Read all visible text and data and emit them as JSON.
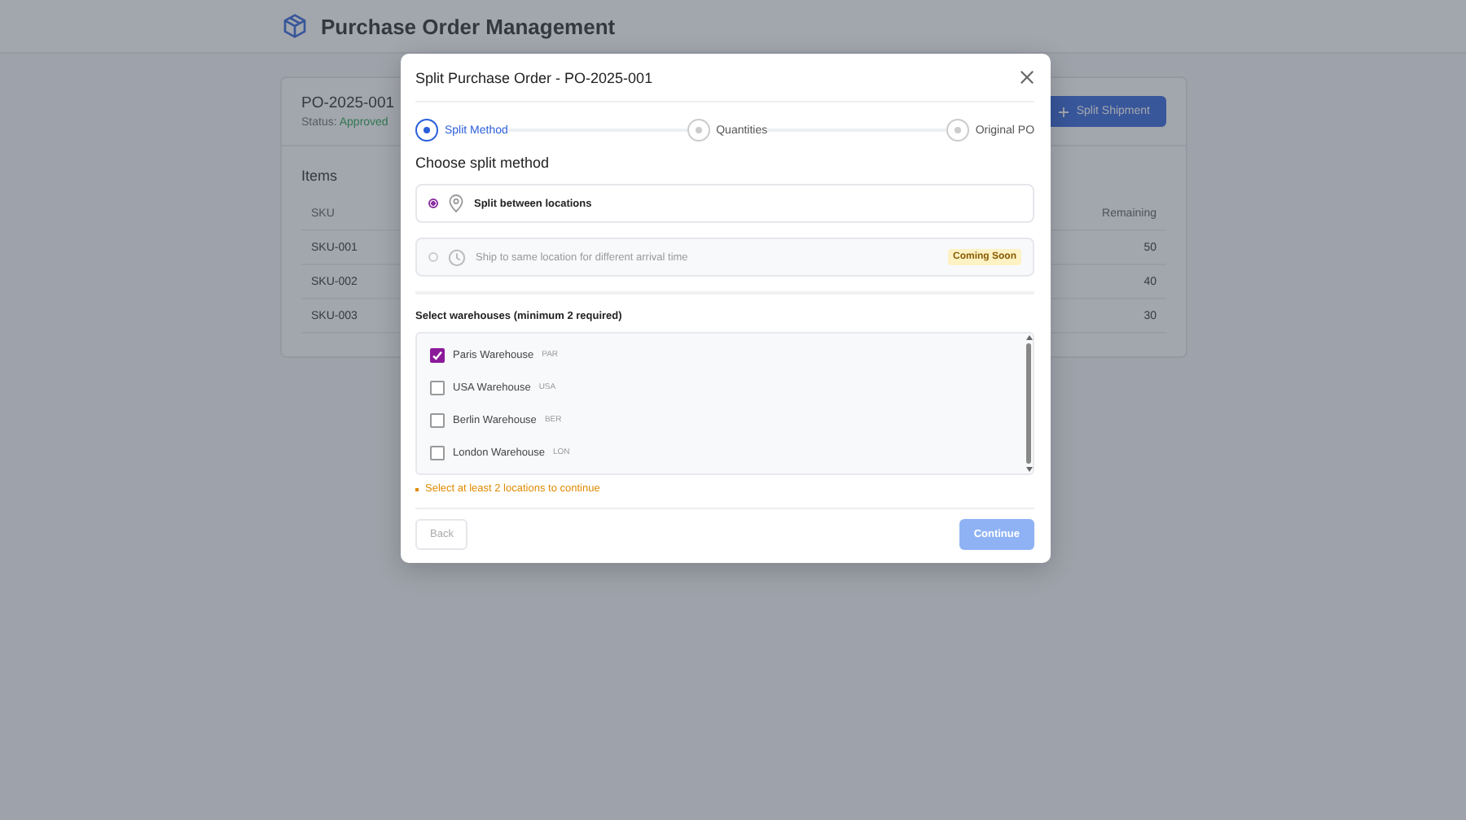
{
  "header": {
    "title": "Purchase Order Management"
  },
  "order": {
    "number": "PO-2025-001",
    "status_label": "Status:",
    "status": "Approved",
    "split_button": "Split Shipment",
    "items_title": "Items",
    "columns": [
      "SKU",
      "Remaining"
    ],
    "rows": [
      {
        "sku": "SKU-001",
        "remaining": "50"
      },
      {
        "sku": "SKU-002",
        "remaining": "40"
      },
      {
        "sku": "SKU-003",
        "remaining": "30"
      }
    ]
  },
  "dialog": {
    "title": "Split Purchase Order - PO-2025-001",
    "steps": [
      {
        "label": "Split Method",
        "selected": true
      },
      {
        "label": "Quantities",
        "selected": false
      },
      {
        "label": "Original PO",
        "selected": false
      }
    ],
    "method_heading": "Choose split method",
    "methods": [
      {
        "label": "Split between locations",
        "kind": "location",
        "selected": true,
        "disabled": false
      },
      {
        "label": "Ship to same location for different arrival time",
        "kind": "time",
        "selected": false,
        "disabled": true,
        "badge": "Coming Soon"
      }
    ],
    "warehouses_heading": "Select warehouses (minimum 2 required)",
    "warehouses": [
      {
        "name": "Paris Warehouse",
        "code": "PAR",
        "checked": true
      },
      {
        "name": "USA Warehouse",
        "code": "USA",
        "checked": false
      },
      {
        "name": "Berlin Warehouse",
        "code": "BER",
        "checked": false
      },
      {
        "name": "London Warehouse",
        "code": "LON",
        "checked": false
      }
    ],
    "warning": "Select at least 2 locations to continue",
    "back_button": "Back",
    "continue_button": "Continue"
  }
}
